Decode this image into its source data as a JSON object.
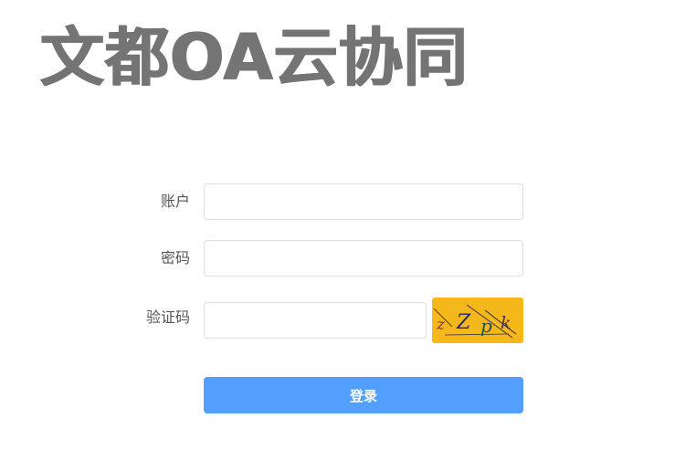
{
  "header": {
    "logo_text": "文都OA云协同"
  },
  "form": {
    "account_label": "账户",
    "account_value": "",
    "password_label": "密码",
    "password_value": "",
    "captcha_label": "验证码",
    "captcha_value": "",
    "captcha_chars": [
      "z",
      "Z",
      "p",
      "k"
    ],
    "login_label": "登录"
  },
  "colors": {
    "logo": "#747474",
    "button": "#539ffe",
    "captcha_bg": "#f5b81a"
  }
}
